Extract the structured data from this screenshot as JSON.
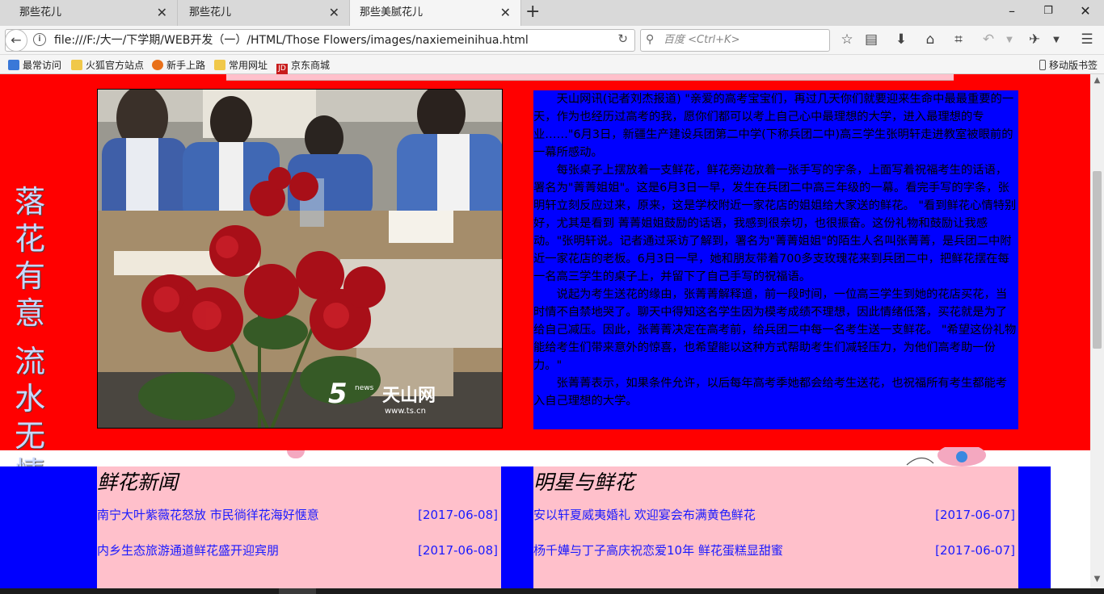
{
  "browser": {
    "tabs": [
      {
        "label": "那些花儿"
      },
      {
        "label": "那些花儿"
      },
      {
        "label": "那些美腻花儿"
      }
    ],
    "url": "file:///F:/大一/下学期/WEB开发（一）/HTML/Those Flowers/images/naxiemeinihua.html",
    "search_placeholder": "百度 <Ctrl+K>",
    "bookmarks": [
      {
        "label": "最常访问",
        "icon": "star-folder-icon"
      },
      {
        "label": "火狐官方站点",
        "icon": "folder-icon"
      },
      {
        "label": "新手上路",
        "icon": "firefox-icon"
      },
      {
        "label": "常用网址",
        "icon": "folder-icon"
      },
      {
        "label": "京东商城",
        "icon": "jd-icon"
      }
    ],
    "mobile_bookmarks": "移动版书签"
  },
  "page": {
    "side_text_top": [
      "落",
      "花",
      "有",
      "意"
    ],
    "side_text_bottom": [
      "流",
      "水",
      "无",
      "情"
    ],
    "photo_watermark": "天山网",
    "photo_watermark_sub": "news",
    "photo_watermark_url": "www.ts.cn",
    "article_paragraphs": [
      "天山网讯(记者刘杰报道) \"亲爱的高考宝宝们，再过几天你们就要迎来生命中最最重要的一天，作为也经历过高考的我，愿你们都可以考上自己心中最理想的大学，进入最理想的专业……\"6月3日，新疆生产建设兵团第二中学(下称兵团二中)高三学生张明轩走进教室被眼前的一幕所感动。",
      "每张桌子上摆放着一支鲜花，鲜花旁边放着一张手写的字条，上面写着祝福考生的话语，署名为\"菁菁姐姐\"。这是6月3日一早，发生在兵团二中高三年级的一幕。看完手写的字条，张明轩立刻反应过来，原来，这是学校附近一家花店的姐姐给大家送的鲜花。 \"看到鲜花心情特别好，尤其是看到 菁菁姐姐鼓励的话语，我感到很亲切，也很振奋。这份礼物和鼓励让我感动。\"张明轩说。记者通过采访了解到，署名为\"菁菁姐姐\"的陌生人名叫张菁菁，是兵团二中附近一家花店的老板。6月3日一早，她和朋友带着700多支玫瑰花来到兵团二中，把鲜花摆在每一名高三学生的桌子上，并留下了自己手写的祝福语。",
      "说起为考生送花的缘由，张菁菁解释道，前一段时间，一位高三学生到她的花店买花，当时情不自禁地哭了。聊天中得知这名学生因为模考成绩不理想，因此情绪低落，买花就是为了给自己减压。因此，张菁菁决定在高考前，给兵团二中每一名考生送一支鲜花。 \"希望这份礼物能给考生们带来意外的惊喜，也希望能以这种方式帮助考生们减轻压力，为他们高考助一份力。\"",
      "张菁菁表示，如果条件允许，以后每年高考季她都会给考生送花，也祝福所有考生都能考入自己理想的大学。"
    ],
    "news_left": {
      "title": "鲜花新闻",
      "items": [
        {
          "text": "南宁大叶紫薇花怒放  市民徜徉花海好惬意",
          "date": "[2017-06-08]"
        },
        {
          "text": "内乡生态旅游通道鲜花盛开迎宾朋",
          "date": "[2017-06-08]"
        }
      ]
    },
    "news_right": {
      "title": "明星与鲜花",
      "items": [
        {
          "text": "安以轩夏威夷婚礼  欢迎宴会布满黄色鲜花",
          "date": "[2017-06-07]"
        },
        {
          "text": "杨千嬅与丁子高庆祝恋爱10年  鲜花蛋糕显甜蜜",
          "date": "[2017-06-07]"
        }
      ]
    },
    "colors": {
      "red_band": "#ff0000",
      "article_bg": "#0000ff",
      "news_bg": "#ffc0cb",
      "link": "#1a1aff"
    }
  }
}
